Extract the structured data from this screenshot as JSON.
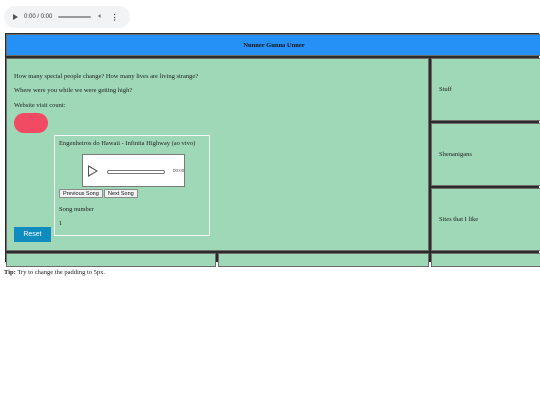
{
  "audio_top": {
    "time": "0:00 / 0:00"
  },
  "header": {
    "title": "Nunner Gunna Unner"
  },
  "main": {
    "question1": "How many special people change? How many lives are living strange?",
    "question2": "Where were you while we were getting high?",
    "visit_label": "Website visit count:",
    "reset_label": "Reset"
  },
  "song_box": {
    "title": "Engenheiros do Hawaii - Infinita Highway (ao vivo)",
    "player_time": "00:00",
    "prev_label": "Previous Song",
    "next_label": "Next Song",
    "number_label": "Song number",
    "number_value": "1"
  },
  "sidebar": {
    "items": [
      {
        "label": "Stuff"
      },
      {
        "label": "Shenanigans"
      },
      {
        "label": "Sites that I like"
      }
    ]
  },
  "tip": {
    "bold": "Tip:",
    "text": " Try to change the padding to 5px."
  },
  "colors": {
    "header_bg": "#2590f5",
    "panel_bg": "#9fd8b7",
    "visit_button": "#f24a63",
    "reset_button": "#0e8cbf"
  },
  "icons": [
    "play-icon",
    "volume-icon",
    "more-options-icon"
  ]
}
